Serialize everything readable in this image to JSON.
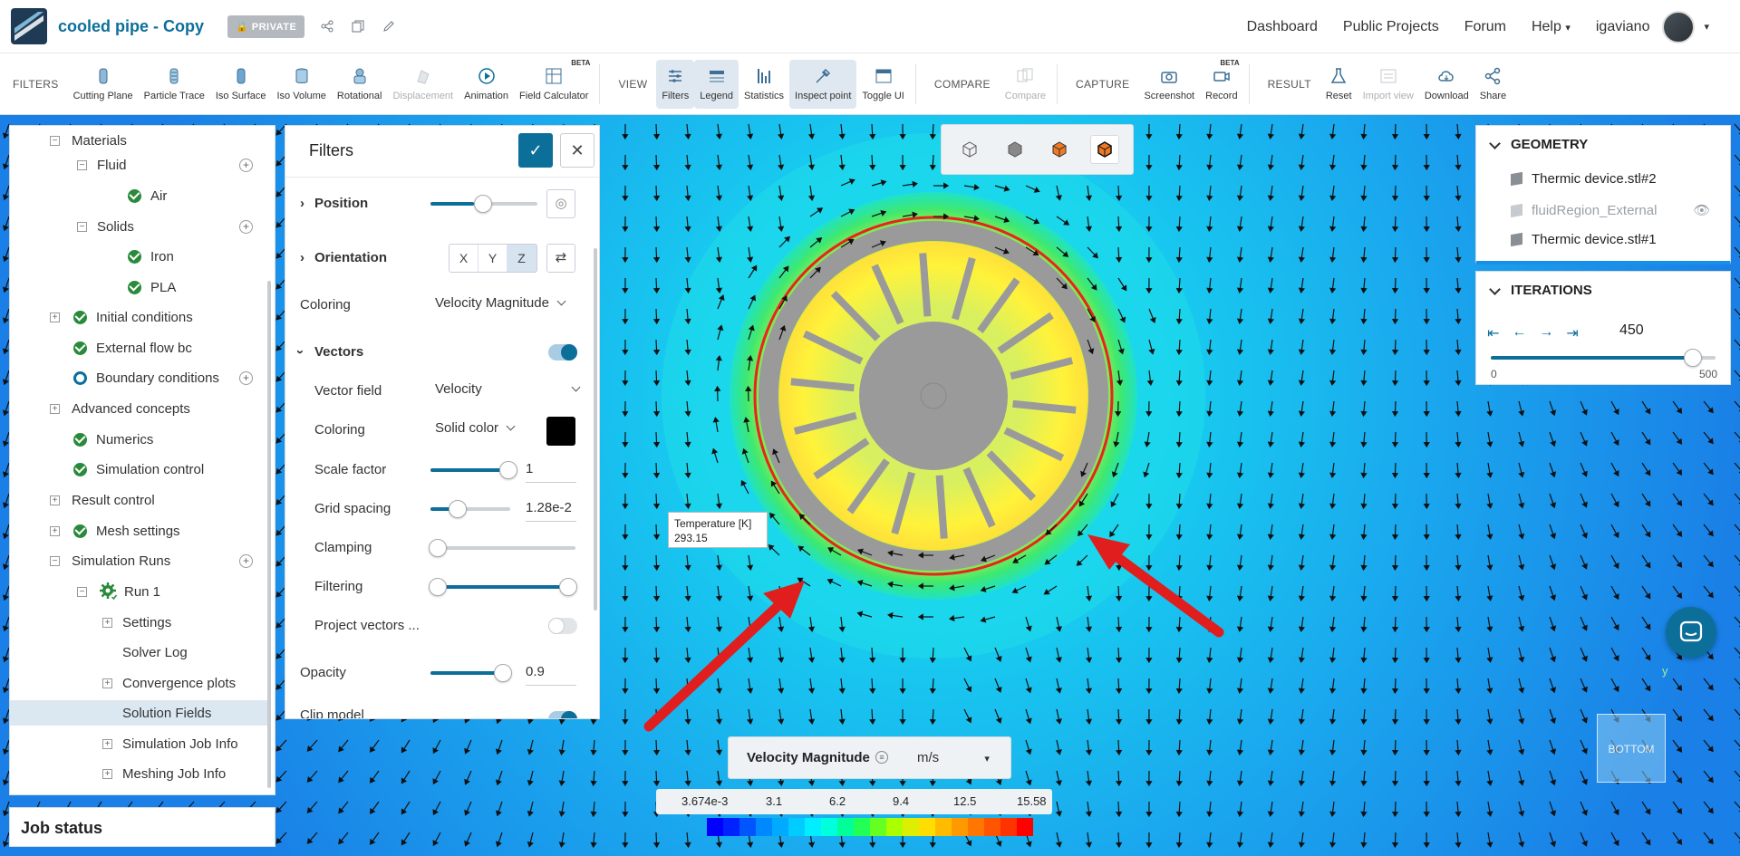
{
  "header": {
    "project_title": "cooled pipe - Copy",
    "private_badge": "PRIVATE",
    "nav": {
      "dashboard": "Dashboard",
      "public_projects": "Public Projects",
      "forum": "Forum",
      "help": "Help",
      "username": "igaviano"
    }
  },
  "toolbar": {
    "filters_group": "FILTERS",
    "view_group": "VIEW",
    "compare_group": "COMPARE",
    "capture_group": "CAPTURE",
    "result_group": "RESULT",
    "beta": "BETA",
    "cutting_plane": "Cutting Plane",
    "particle_trace": "Particle Trace",
    "iso_surface": "Iso Surface",
    "iso_volume": "Iso Volume",
    "rotational": "Rotational",
    "displacement": "Displacement",
    "animation": "Animation",
    "field_calculator": "Field Calculator",
    "filters": "Filters",
    "legend": "Legend",
    "statistics": "Statistics",
    "inspect_point": "Inspect point",
    "toggle_ui": "Toggle UI",
    "compare": "Compare",
    "screenshot": "Screenshot",
    "record": "Record",
    "reset": "Reset",
    "import_view": "Import view",
    "download": "Download",
    "share": "Share"
  },
  "tree": {
    "materials": "Materials",
    "fluid": "Fluid",
    "air": "Air",
    "solids": "Solids",
    "iron": "Iron",
    "pla": "PLA",
    "initial_conditions": "Initial conditions",
    "external_flow_bc": "External flow bc",
    "boundary_conditions": "Boundary conditions",
    "advanced_concepts": "Advanced concepts",
    "numerics": "Numerics",
    "simulation_control": "Simulation control",
    "result_control": "Result control",
    "mesh_settings": "Mesh settings",
    "simulation_runs": "Simulation Runs",
    "run1": "Run 1",
    "settings": "Settings",
    "solver_log": "Solver Log",
    "convergence_plots": "Convergence plots",
    "solution_fields": "Solution Fields",
    "simulation_job_info": "Simulation Job Info",
    "meshing_job_info": "Meshing Job Info"
  },
  "job_status": "Job status",
  "filters_panel": {
    "title": "Filters",
    "position": "Position",
    "orientation": "Orientation",
    "axes": {
      "x": "X",
      "y": "Y",
      "z": "Z"
    },
    "coloring_label": "Coloring",
    "coloring_value": "Velocity Magnitude",
    "vectors": "Vectors",
    "vector_field_label": "Vector field",
    "vector_field_value": "Velocity",
    "vec_coloring_label": "Coloring",
    "vec_coloring_value": "Solid color",
    "solid_color": "#000000",
    "scale_factor_label": "Scale factor",
    "scale_factor_value": "1",
    "grid_spacing_label": "Grid spacing",
    "grid_spacing_value": "1.28e-2",
    "clamping_label": "Clamping",
    "filtering_label": "Filtering",
    "project_vectors_label": "Project vectors ...",
    "opacity_label": "Opacity",
    "opacity_value": "0.9",
    "clip_model_label": "Clip model"
  },
  "geometry": {
    "title": "GEOMETRY",
    "items": [
      "Thermic device.stl#2",
      "fluidRegion_External",
      "Thermic device.stl#1"
    ]
  },
  "iterations": {
    "title": "ITERATIONS",
    "value": "450",
    "min_label": "0",
    "max_label": "500"
  },
  "probe": {
    "label": "Temperature [K]",
    "value": "293.15"
  },
  "legend": {
    "title": "Velocity Magnitude",
    "unit": "m/s",
    "ticks": [
      "3.674e-3",
      "3.1",
      "6.2",
      "9.4",
      "12.5",
      "15.58"
    ]
  },
  "orientation_cube_label": "BOTTOM",
  "axis_label": "y"
}
